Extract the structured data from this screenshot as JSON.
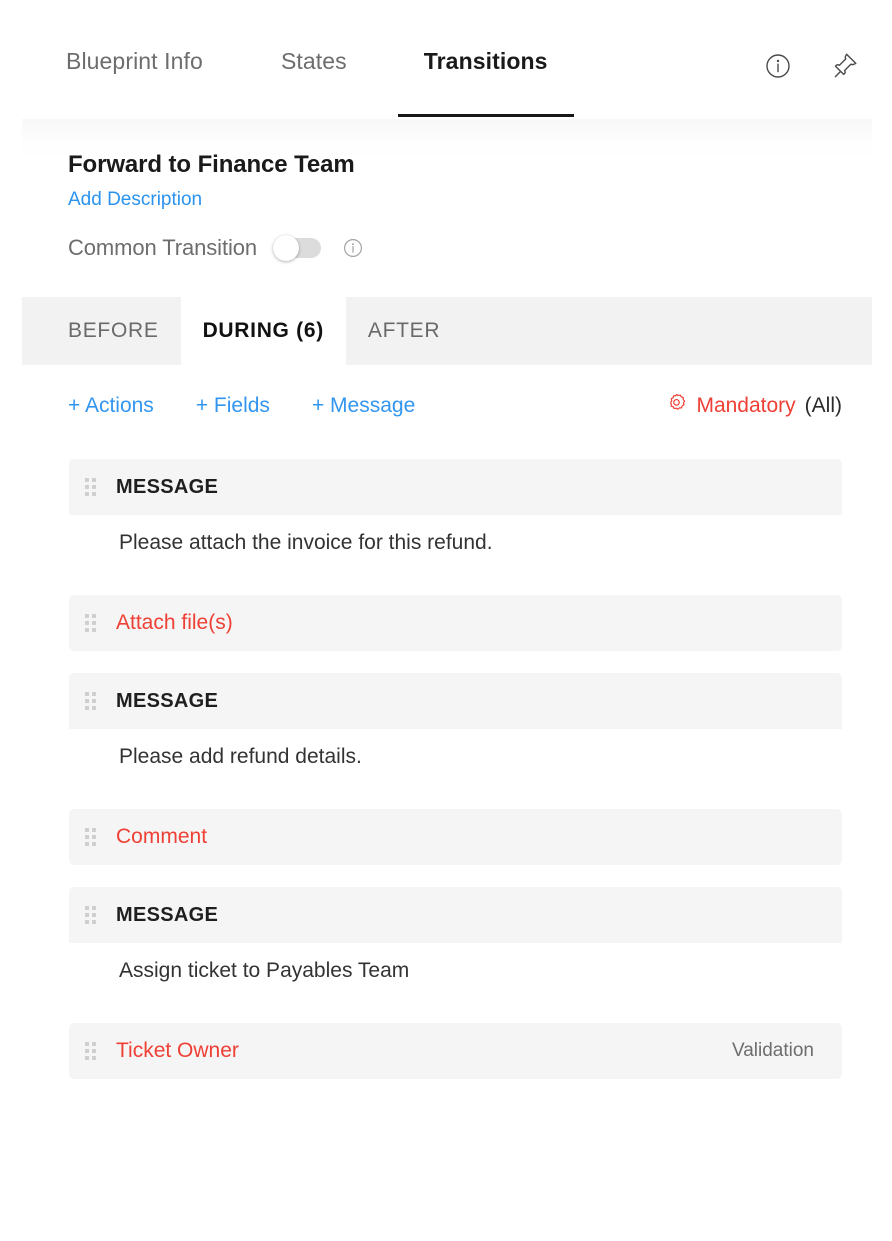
{
  "header": {
    "tabs": [
      {
        "label": "Blueprint Info",
        "active": false
      },
      {
        "label": "States",
        "active": false
      },
      {
        "label": "Transitions",
        "active": true
      }
    ],
    "info_icon": "info-circle-icon",
    "pin_icon": "pin-icon"
  },
  "transition": {
    "title": "Forward to Finance Team",
    "add_description_label": "Add Description",
    "common_transition_label": "Common Transition",
    "common_transition_on": false,
    "common_transition_info_icon": "info-circle-icon"
  },
  "phase_tabs": [
    {
      "label": "BEFORE",
      "active": false
    },
    {
      "label": "DURING (6)",
      "active": true
    },
    {
      "label": "AFTER",
      "active": false
    }
  ],
  "toolbar": {
    "links": [
      {
        "label": "+ Actions"
      },
      {
        "label": "+ Fields"
      },
      {
        "label": "+ Message"
      }
    ],
    "mandatory_icon": "gear-icon",
    "mandatory_label": "Mandatory",
    "mandatory_scope": "(All)"
  },
  "items": [
    {
      "type": "message",
      "head_label": "MESSAGE",
      "body": "Please attach the invoice for this refund."
    },
    {
      "type": "field",
      "label": "Attach file(s)",
      "meta": ""
    },
    {
      "type": "message",
      "head_label": "MESSAGE",
      "body": "Please add refund details."
    },
    {
      "type": "field",
      "label": "Comment",
      "meta": ""
    },
    {
      "type": "message",
      "head_label": "MESSAGE",
      "body": "Assign ticket to Payables Team"
    },
    {
      "type": "field",
      "label": "Ticket Owner",
      "meta": "Validation"
    }
  ],
  "colors": {
    "link_blue": "#3296f0",
    "mandatory_red": "#ef4035",
    "active_tab_underline": "#181818",
    "panel_gray": "#f2f2f2",
    "card_gray": "#f5f5f5"
  }
}
